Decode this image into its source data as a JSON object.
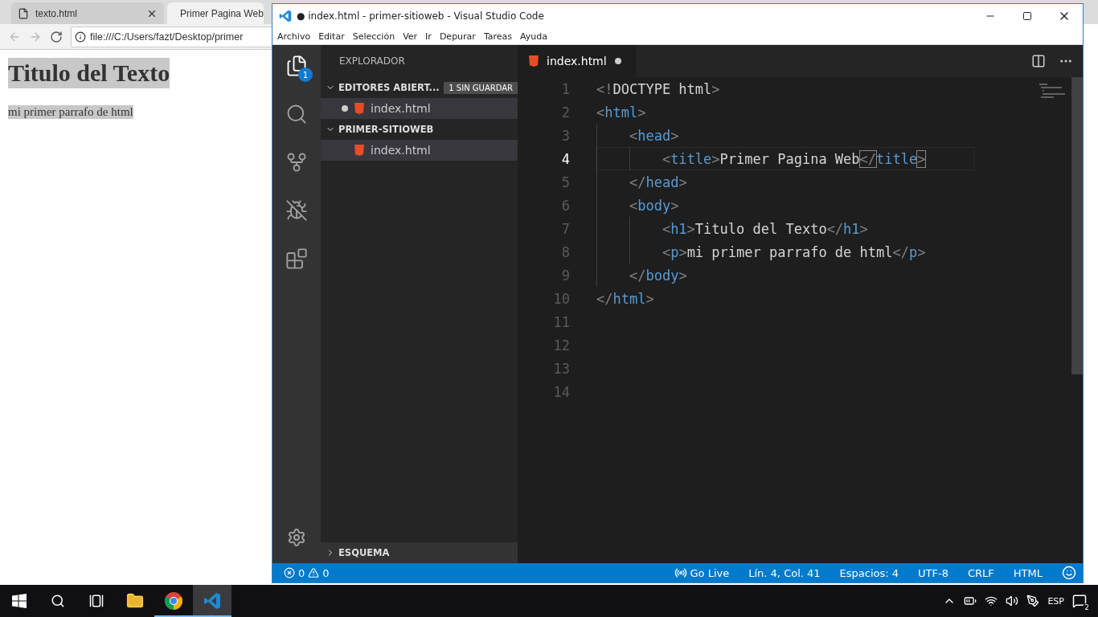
{
  "browser": {
    "tabs": [
      {
        "title": "texto.html",
        "selected": false,
        "close_button": true
      },
      {
        "title": "Primer Pagina Web",
        "selected": true,
        "close_button": false
      }
    ],
    "address": {
      "value": "file:///C:/Users/fazt/Desktop/primer"
    },
    "page": {
      "heading": "Titulo del Texto",
      "paragraph": "mi primer parrafo de html",
      "highlighted": true
    }
  },
  "vscode": {
    "title": "● index.html - primer-sitioweb - Visual Studio Code",
    "menu": [
      "Archivo",
      "Editar",
      "Selección",
      "Ver",
      "Ir",
      "Depurar",
      "Tareas",
      "Ayuda"
    ],
    "activity": [
      {
        "kind": "files",
        "selected": true,
        "badge": "1"
      },
      {
        "kind": "search",
        "selected": false
      },
      {
        "kind": "git",
        "selected": false
      },
      {
        "kind": "debug",
        "selected": false
      },
      {
        "kind": "extensions",
        "selected": false
      }
    ],
    "sidebar": {
      "title": "EXPLORADOR",
      "sections": [
        {
          "label": "EDITORES ABIERT...",
          "expanded": true,
          "badge": "1 SIN GUARDAR",
          "items": [
            {
              "label": "index.html",
              "dirty": true,
              "selected": true
            }
          ]
        },
        {
          "label": "PRIMER-SITIOWEB",
          "expanded": true,
          "items": [
            {
              "label": "index.html",
              "dirty": false,
              "selected": true
            }
          ]
        }
      ],
      "outline": {
        "label": "ESQUEMA",
        "expanded": false
      }
    },
    "editor": {
      "tabs": [
        {
          "label": "index.html",
          "dirty": true,
          "selected": true
        }
      ],
      "lines": [
        {
          "number": "1",
          "selected": false,
          "tokens": [
            {
              "kind": "punct",
              "text": "<!"
            },
            {
              "kind": "text",
              "text": "DOCTYPE html"
            },
            {
              "kind": "punct",
              "text": ">"
            }
          ]
        },
        {
          "number": "2",
          "selected": false,
          "tokens": [
            {
              "kind": "punct",
              "text": "<"
            },
            {
              "kind": "tag",
              "text": "html"
            },
            {
              "kind": "punct",
              "text": ">"
            }
          ],
          "children": [
            {
              "number": "3",
              "selected": false,
              "tokens": [
                {
                  "kind": "punct",
                  "text": "<"
                },
                {
                  "kind": "tag",
                  "text": "head"
                },
                {
                  "kind": "punct",
                  "text": ">"
                }
              ],
              "children": [
                {
                  "number": "4",
                  "selected": true,
                  "tokens": [
                    {
                      "kind": "punct",
                      "text": "<"
                    },
                    {
                      "kind": "tag",
                      "text": "title"
                    },
                    {
                      "kind": "punct",
                      "text": ">"
                    },
                    {
                      "kind": "text",
                      "text": "Primer Pagina Web"
                    },
                    {
                      "kind": "punct",
                      "text": "</",
                      "match": true
                    },
                    {
                      "kind": "tag",
                      "text": "title"
                    },
                    {
                      "kind": "punct",
                      "text": ">",
                      "match": true
                    }
                  ]
                }
              ]
            },
            {
              "number": "5",
              "selected": false,
              "tokens": [
                {
                  "kind": "punct",
                  "text": "</"
                },
                {
                  "kind": "tag",
                  "text": "head"
                },
                {
                  "kind": "punct",
                  "text": ">"
                }
              ]
            },
            {
              "number": "6",
              "selected": false,
              "tokens": [
                {
                  "kind": "punct",
                  "text": "<"
                },
                {
                  "kind": "tag",
                  "text": "body"
                },
                {
                  "kind": "punct",
                  "text": ">"
                }
              ],
              "children": [
                {
                  "number": "7",
                  "selected": false,
                  "tokens": [
                    {
                      "kind": "punct",
                      "text": "<"
                    },
                    {
                      "kind": "tag",
                      "text": "h1"
                    },
                    {
                      "kind": "punct",
                      "text": ">"
                    },
                    {
                      "kind": "text",
                      "text": "Titulo del Texto"
                    },
                    {
                      "kind": "punct",
                      "text": "</"
                    },
                    {
                      "kind": "tag",
                      "text": "h1"
                    },
                    {
                      "kind": "punct",
                      "text": ">"
                    }
                  ]
                },
                {
                  "number": "8",
                  "selected": false,
                  "tokens": [
                    {
                      "kind": "punct",
                      "text": "<"
                    },
                    {
                      "kind": "tag",
                      "text": "p"
                    },
                    {
                      "kind": "punct",
                      "text": ">"
                    },
                    {
                      "kind": "text",
                      "text": "mi primer parrafo de html"
                    },
                    {
                      "kind": "punct",
                      "text": "</"
                    },
                    {
                      "kind": "tag",
                      "text": "p"
                    },
                    {
                      "kind": "punct",
                      "text": ">"
                    }
                  ]
                }
              ]
            },
            {
              "number": "9",
              "selected": false,
              "tokens": [
                {
                  "kind": "punct",
                  "text": "</"
                },
                {
                  "kind": "tag",
                  "text": "body"
                },
                {
                  "kind": "punct",
                  "text": ">"
                }
              ]
            }
          ]
        },
        {
          "number": "10",
          "selected": false,
          "tokens": [
            {
              "kind": "punct",
              "text": "</"
            },
            {
              "kind": "tag",
              "text": "html"
            },
            {
              "kind": "punct",
              "text": ">"
            }
          ]
        },
        {
          "number": "11",
          "selected": false
        },
        {
          "number": "12",
          "selected": false
        },
        {
          "number": "13",
          "selected": false
        },
        {
          "number": "14",
          "selected": false
        }
      ]
    },
    "status_bar": {
      "errors": "0",
      "warnings": "0",
      "items": [
        {
          "kind": "live",
          "text": "Go Live"
        },
        {
          "kind": "text",
          "text": "Lín. 4, Col. 41"
        },
        {
          "kind": "text",
          "text": "Espacios: 4"
        },
        {
          "kind": "text",
          "text": "UTF-8"
        },
        {
          "kind": "text",
          "text": "CRLF"
        },
        {
          "kind": "text",
          "text": "HTML"
        },
        {
          "kind": "feedback"
        }
      ]
    }
  },
  "taskbar": {
    "apps": [
      {
        "kind": "start",
        "running": false,
        "selected": false
      },
      {
        "kind": "search",
        "running": false,
        "selected": false
      },
      {
        "kind": "taskview",
        "running": false,
        "selected": false
      },
      {
        "kind": "explorer",
        "running": false,
        "selected": false
      },
      {
        "kind": "chrome",
        "running": true,
        "selected": false
      },
      {
        "kind": "vscode",
        "running": true,
        "selected": true
      }
    ],
    "tray": {
      "language": "ESP",
      "notifications": "2"
    }
  }
}
